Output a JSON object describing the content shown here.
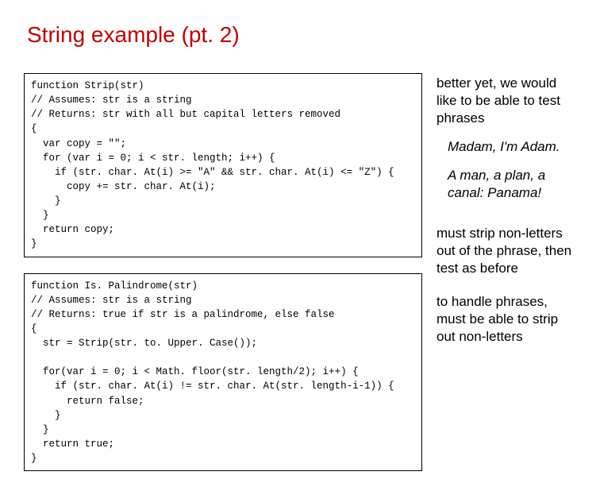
{
  "title": "String example (pt. 2)",
  "code": {
    "block1": "function Strip(str)\n// Assumes: str is a string\n// Returns: str with all but capital letters removed\n{\n  var copy = \"\";\n  for (var i = 0; i < str. length; i++) {\n    if (str. char. At(i) >= \"A\" && str. char. At(i) <= \"Z\") {\n      copy += str. char. At(i);\n    }\n  }\n  return copy;\n}",
    "block2": "function Is. Palindrome(str)\n// Assumes: str is a string\n// Returns: true if str is a palindrome, else false\n{\n  str = Strip(str. to. Upper. Case());\n\n  for(var i = 0; i < Math. floor(str. length/2); i++) {\n    if (str. char. At(i) != str. char. At(str. length-i-1)) {\n      return false;\n    }\n  }\n  return true;\n}"
  },
  "side": {
    "p1": "better yet, we would like to be able to test phrases",
    "q1": "Madam, I'm Adam.",
    "q2": "A man, a plan, a canal: Panama!",
    "p2": "must strip non-letters out of the phrase, then test as before",
    "p3": "to handle phrases, must be able to strip out non-letters"
  }
}
